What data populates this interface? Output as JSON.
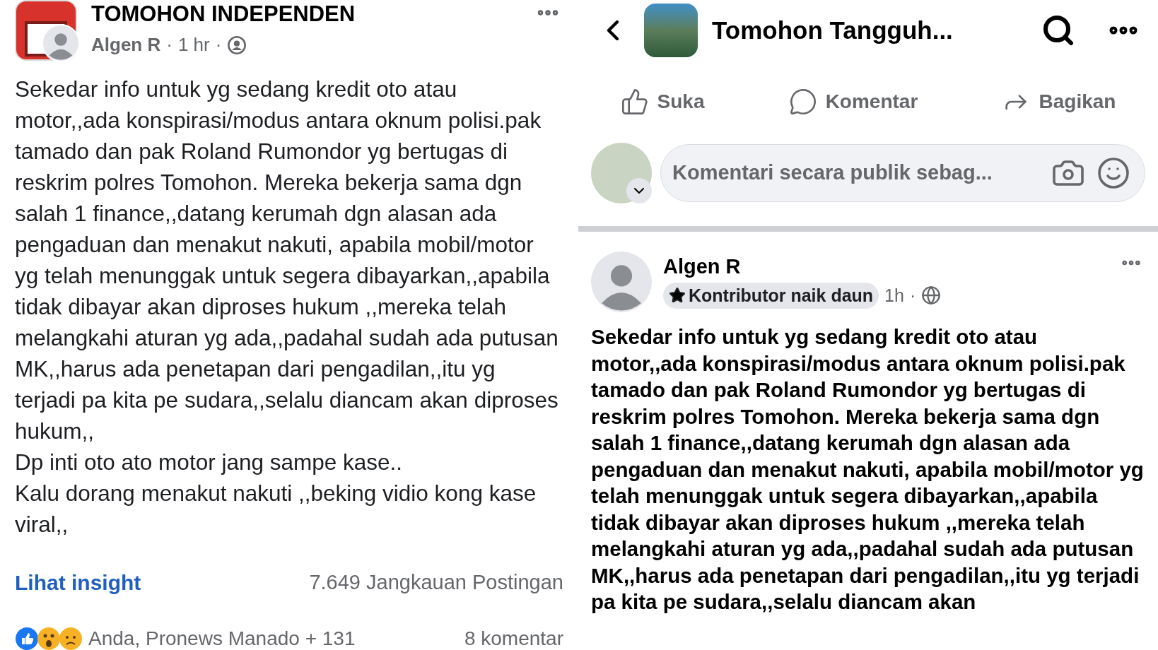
{
  "left_post": {
    "page_name": "TOMOHON INDEPENDEN",
    "author": "Algen R",
    "time": "1 hr",
    "separator": "·",
    "paragraphs": [
      "Sekedar info untuk yg sedang kredit oto atau motor,,ada konspirasi/modus  antara oknum polisi.pak tamado dan pak Roland Rumondor yg bertugas di reskrim polres Tomohon. Mereka bekerja sama dgn salah 1 finance,,datang kerumah dgn alasan ada pengaduan dan menakut nakuti, apabila mobil/motor yg telah menunggak untuk segera dibayarkan,,apabila tidak dibayar akan diproses hukum ,,mereka telah melangkahi aturan yg ada,,padahal sudah ada putusan MK,,harus ada penetapan dari pengadilan,,itu yg terjadi pa kita pe sudara,,selalu diancam akan diproses hukum,,",
      "Dp inti oto ato motor jang sampe kase..",
      "Kalu dorang menakut nakuti ,,beking vidio kong kase viral,,"
    ],
    "insight_link": "Lihat insight",
    "reach": "7.649 Jangkauan Postingan",
    "reactions_text": "Anda, Pronews Manado + 131",
    "comments": "8 komentar"
  },
  "right_post": {
    "group_title": "Tomohon Tangguh...",
    "actions": [
      {
        "kind": "like",
        "label": "Suka"
      },
      {
        "kind": "comment",
        "label": "Komentar"
      },
      {
        "kind": "share",
        "label": "Bagikan"
      }
    ],
    "comment_placeholder": "Komentari secara publik sebag...",
    "author": "Algen R",
    "badge": "Kontributor naik daun",
    "time": "1h",
    "separator": "·",
    "text": "Sekedar info untuk yg sedang kredit oto atau motor,,ada konspirasi/modus  antara oknum polisi.pak tamado dan pak Roland Rumondor yg bertugas di reskrim polres Tomohon. Mereka bekerja sama dgn salah 1 finance,,datang kerumah dgn alasan ada pengaduan dan menakut nakuti, apabila mobil/motor yg telah menunggak untuk segera dibayarkan,,apabila tidak dibayar akan diproses hukum ,,mereka telah melangkahi aturan yg ada,,padahal sudah ada putusan MK,,harus ada penetapan dari pengadilan,,itu yg terjadi pa kita pe sudara,,selalu diancam akan"
  }
}
